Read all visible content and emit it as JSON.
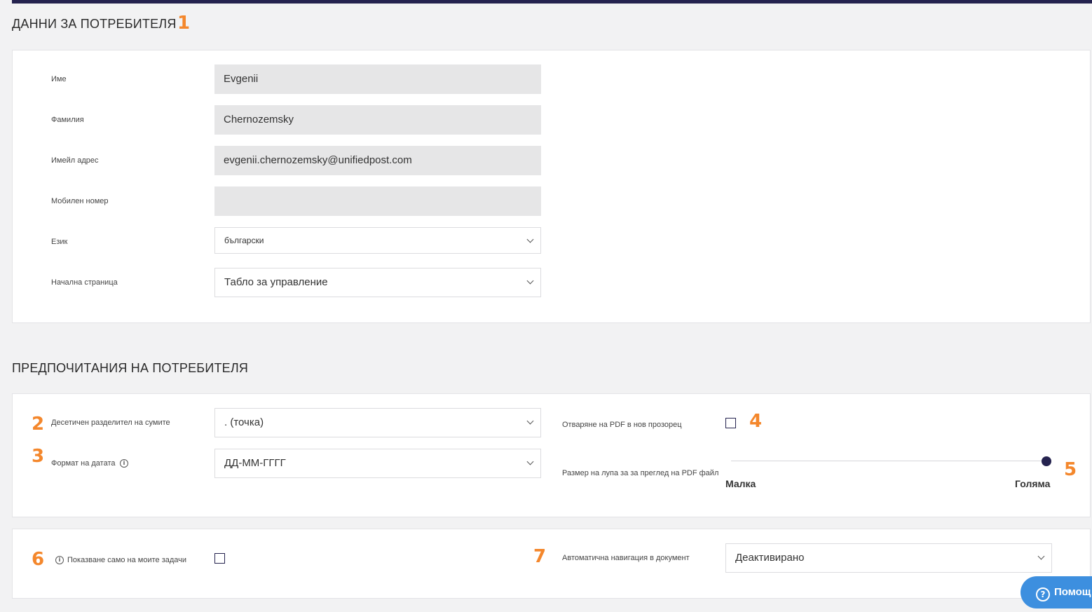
{
  "user_data": {
    "title": "ДАННИ ЗА ПОТРЕБИТЕЛЯ",
    "marker": "1",
    "first_name": {
      "label": "Име",
      "value": "Evgenii"
    },
    "last_name": {
      "label": "Фамилия",
      "value": "Chernozemsky"
    },
    "email": {
      "label": "Имейл адрес",
      "value": "evgenii.chernozemsky@unifiedpost.com"
    },
    "mobile": {
      "label": "Мобилен номер",
      "value": ""
    },
    "language": {
      "label": "Език",
      "value": "български"
    },
    "start_page": {
      "label": "Начална страница",
      "value": "Табло за управление"
    }
  },
  "preferences": {
    "title": "ПРЕДПОЧИТАНИЯ НА ПОТРЕБИТЕЛЯ",
    "decimal_separator": {
      "marker": "2",
      "label": "Десетичен разделител на сумите",
      "value": ". (точка)"
    },
    "date_format": {
      "marker": "3",
      "label": "Формат на датата",
      "value": "ДД-ММ-ГГГГ"
    },
    "pdf_new_window": {
      "marker": "4",
      "label": "Отваряне на PDF в нов прозорец",
      "checked": false
    },
    "magnifier": {
      "marker": "5",
      "label": "Размер на лупа за за преглед на PDF файл",
      "min_label": "Малка",
      "max_label": "Голяма",
      "value_fraction": 1.0
    },
    "my_tasks_only": {
      "marker": "6",
      "label": "Показване само на моите задачи",
      "checked": false
    },
    "auto_navigation": {
      "marker": "7",
      "label": "Автоматична навигация в документ",
      "value": "Деактивирано"
    }
  },
  "help_button": {
    "label": "Помощ"
  },
  "colors": {
    "accent": "#25234f",
    "marker": "#f4872c",
    "help": "#3d8fdf"
  },
  "icons": {
    "info": "info-icon",
    "chevron": "chevron-down-icon",
    "help": "question-circle-icon"
  }
}
